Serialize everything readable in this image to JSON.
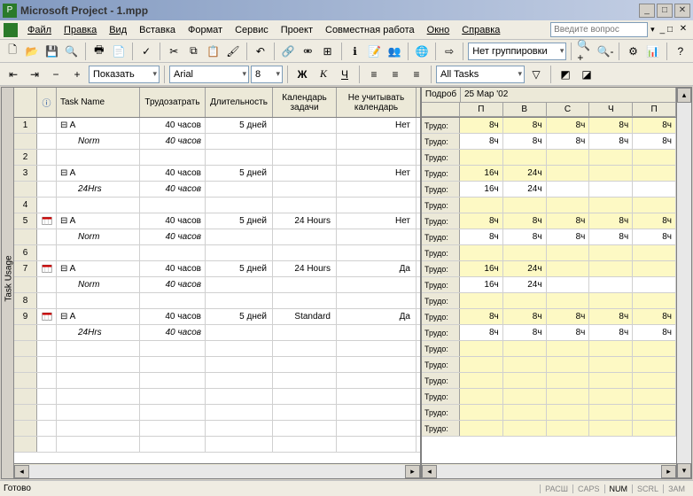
{
  "titlebar": {
    "title": "Microsoft Project - 1.mpp"
  },
  "menu": {
    "file": "Файл",
    "edit": "Правка",
    "view": "Вид",
    "insert": "Вставка",
    "format": "Формат",
    "tools": "Сервис",
    "project": "Проект",
    "collab": "Совместная работа",
    "window": "Окно",
    "help": "Справка"
  },
  "ask_placeholder": "Введите вопрос",
  "toolbar": {
    "show": "Показать",
    "font": "Arial",
    "size": "8",
    "group": "Нет группировки",
    "filter": "All Tasks"
  },
  "left": {
    "headers": {
      "task_name": "Task Name",
      "work": "Трудозатрать",
      "duration": "Длительность",
      "calendar": "Календарь задачи",
      "ignore": "Не учитывать календарь"
    },
    "rows": [
      {
        "n": "1",
        "name": "⊟ A",
        "work": "40 часов",
        "dur": "5 дней",
        "cal": "",
        "ign": "Нет"
      },
      {
        "sub": true,
        "name": "Norm",
        "work": "40 часов"
      },
      {
        "n": "2"
      },
      {
        "n": "3",
        "name": "⊟ A",
        "work": "40 часов",
        "dur": "5 дней",
        "cal": "",
        "ign": "Нет"
      },
      {
        "sub": true,
        "name": "24Hrs",
        "work": "40 часов"
      },
      {
        "n": "4"
      },
      {
        "n": "5",
        "icon": true,
        "name": "⊟ A",
        "work": "40 часов",
        "dur": "5 дней",
        "cal": "24 Hours",
        "ign": "Нет"
      },
      {
        "sub": true,
        "name": "Norm",
        "work": "40 часов"
      },
      {
        "n": "6"
      },
      {
        "n": "7",
        "icon": true,
        "name": "⊟ A",
        "work": "40 часов",
        "dur": "5 дней",
        "cal": "24 Hours",
        "ign": "Да"
      },
      {
        "sub": true,
        "name": "Norm",
        "work": "40 часов"
      },
      {
        "n": "8"
      },
      {
        "n": "9",
        "icon": true,
        "name": "⊟ A",
        "work": "40 часов",
        "dur": "5 дней",
        "cal": "Standard",
        "ign": "Да"
      },
      {
        "sub": true,
        "name": "24Hrs",
        "work": "40 часов"
      }
    ]
  },
  "right": {
    "detail": "Подроб",
    "date": "25 Мар '02",
    "days": [
      "П",
      "В",
      "С",
      "Ч",
      "П"
    ],
    "row_label": "Трудо:",
    "rows": [
      {
        "yel": true,
        "v": [
          "8ч",
          "8ч",
          "8ч",
          "8ч",
          "8ч"
        ]
      },
      {
        "v": [
          "8ч",
          "8ч",
          "8ч",
          "8ч",
          "8ч"
        ]
      },
      {
        "yel": true,
        "v": [
          "",
          "",
          "",
          "",
          ""
        ]
      },
      {
        "yel": true,
        "v": [
          "16ч",
          "24ч",
          "",
          "",
          ""
        ]
      },
      {
        "v": [
          "16ч",
          "24ч",
          "",
          "",
          ""
        ]
      },
      {
        "yel": true,
        "v": [
          "",
          "",
          "",
          "",
          ""
        ]
      },
      {
        "yel": true,
        "v": [
          "8ч",
          "8ч",
          "8ч",
          "8ч",
          "8ч"
        ]
      },
      {
        "v": [
          "8ч",
          "8ч",
          "8ч",
          "8ч",
          "8ч"
        ]
      },
      {
        "yel": true,
        "v": [
          "",
          "",
          "",
          "",
          ""
        ]
      },
      {
        "yel": true,
        "v": [
          "16ч",
          "24ч",
          "",
          "",
          ""
        ]
      },
      {
        "v": [
          "16ч",
          "24ч",
          "",
          "",
          ""
        ]
      },
      {
        "yel": true,
        "v": [
          "",
          "",
          "",
          "",
          ""
        ]
      },
      {
        "yel": true,
        "v": [
          "8ч",
          "8ч",
          "8ч",
          "8ч",
          "8ч"
        ]
      },
      {
        "v": [
          "8ч",
          "8ч",
          "8ч",
          "8ч",
          "8ч"
        ]
      },
      {
        "yel": true,
        "v": [
          "",
          "",
          "",
          "",
          ""
        ]
      },
      {
        "yel": true,
        "v": [
          "",
          "",
          "",
          "",
          ""
        ]
      },
      {
        "yel": true,
        "v": [
          "",
          "",
          "",
          "",
          ""
        ]
      },
      {
        "yel": true,
        "v": [
          "",
          "",
          "",
          "",
          ""
        ]
      },
      {
        "yel": true,
        "v": [
          "",
          "",
          "",
          "",
          ""
        ]
      },
      {
        "yel": true,
        "v": [
          "",
          "",
          "",
          "",
          ""
        ]
      }
    ]
  },
  "view_name": "Task Usage",
  "status": {
    "ready": "Готово",
    "ext": "РАСШ",
    "caps": "CAPS",
    "num": "NUM",
    "scrl": "SCRL",
    "ovr": "ЗАМ"
  }
}
